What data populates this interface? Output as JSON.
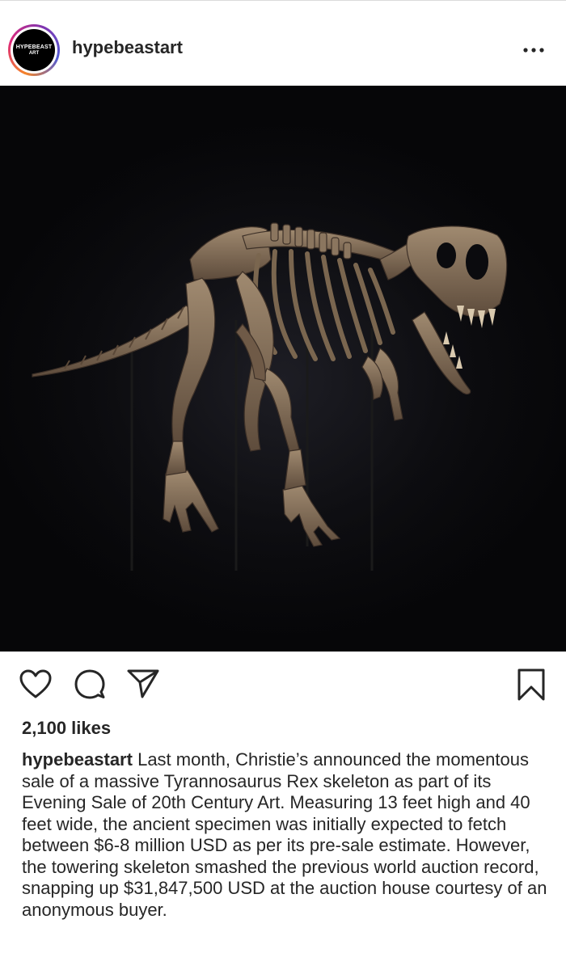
{
  "header": {
    "avatar_line1": "HYPEBEAST",
    "avatar_line2": "ART",
    "username": "hypebeastart",
    "more_icon": "more-horizontal-icon"
  },
  "post": {
    "image_subject": "tyrannosaurus-rex-skeleton"
  },
  "actions": {
    "like_icon": "heart-icon",
    "comment_icon": "comment-icon",
    "share_icon": "send-icon",
    "save_icon": "bookmark-icon"
  },
  "likes": "2,100 likes",
  "caption": {
    "username": "hypebeastart",
    "text": "Last month, Christie’s announced the momentous sale of a massive Tyrannosaurus Rex skeleton as part of its Evening Sale of 20th Century Art. Measuring 13 feet high and 40 feet wide, the ancient specimen was initially expected to fetch between $6-8 million USD as per its pre-sale estimate. However, the towering skeleton smashed the previous world auction record, snapping up $31,847,500 USD at the auction house courtesy of an anonymous buyer."
  },
  "colors": {
    "text": "#262626",
    "image_background": "#0b0b0e",
    "bone": "#8a7560"
  }
}
